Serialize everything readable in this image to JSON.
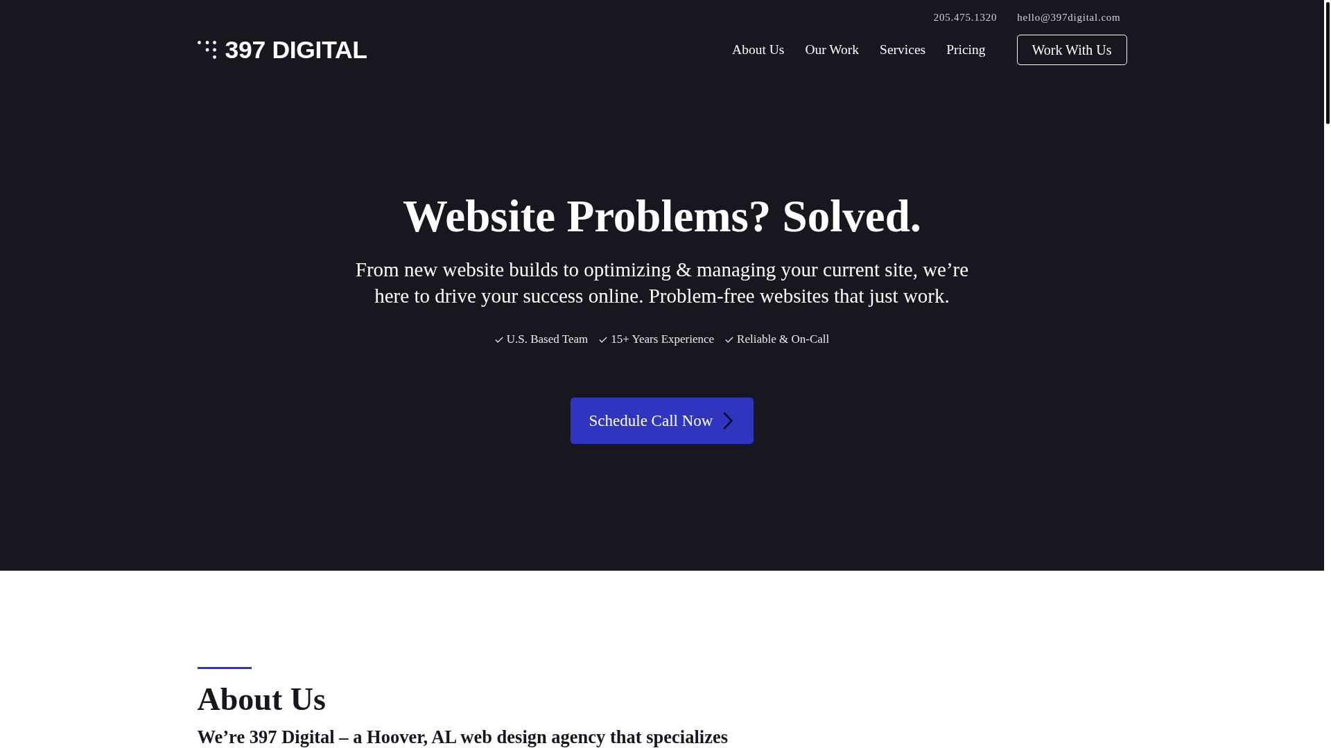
{
  "contact": {
    "phone": "205.475.1320",
    "email": "hello@397digital.com"
  },
  "header": {
    "logo": "397 DIGITAL",
    "nav": [
      "About Us",
      "Our Work",
      "Services",
      "Pricing"
    ],
    "cta": "Work With Us"
  },
  "hero": {
    "title": "Website Problems? Solved.",
    "subtitle": "From new website builds to optimizing & managing your current site, we’re here to drive your success online. Problem-free websites that just work.",
    "features": [
      "U.S. Based Team",
      "15+ Years Experience",
      "Reliable & On-Call"
    ],
    "button": "Schedule Call Now"
  },
  "about": {
    "heading": "About Us",
    "intro": "We’re 397 Digital – a Hoover, AL web design agency that specializes"
  }
}
